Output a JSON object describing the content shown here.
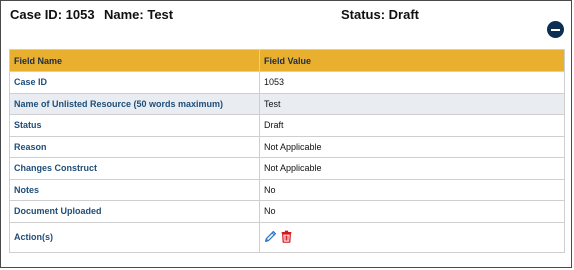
{
  "header": {
    "case_id": "Case ID: 1053",
    "name": "Name: Test",
    "status": "Status: Draft"
  },
  "table": {
    "columns": [
      "Field Name",
      "Field Value"
    ],
    "rows": [
      {
        "field": "Case ID",
        "value": "1053"
      },
      {
        "field": "Name of Unlisted Resource (50 words maximum)",
        "value": "Test"
      },
      {
        "field": "Status",
        "value": "Draft"
      },
      {
        "field": "Reason",
        "value": "Not Applicable"
      },
      {
        "field": "Changes Construct",
        "value": "Not Applicable"
      },
      {
        "field": "Notes",
        "value": "No"
      },
      {
        "field": "Document Uploaded",
        "value": "No"
      },
      {
        "field": "Action(s)",
        "value": ""
      }
    ]
  },
  "actions": {
    "edit_icon": "pencil-icon",
    "delete_icon": "trash-icon"
  },
  "colors": {
    "header_bg": "#e8b02e",
    "label_text": "#1f4e79",
    "collapse_button": "#0b2e52",
    "edit_icon": "#2f77c7",
    "delete_icon": "#d0161c"
  }
}
